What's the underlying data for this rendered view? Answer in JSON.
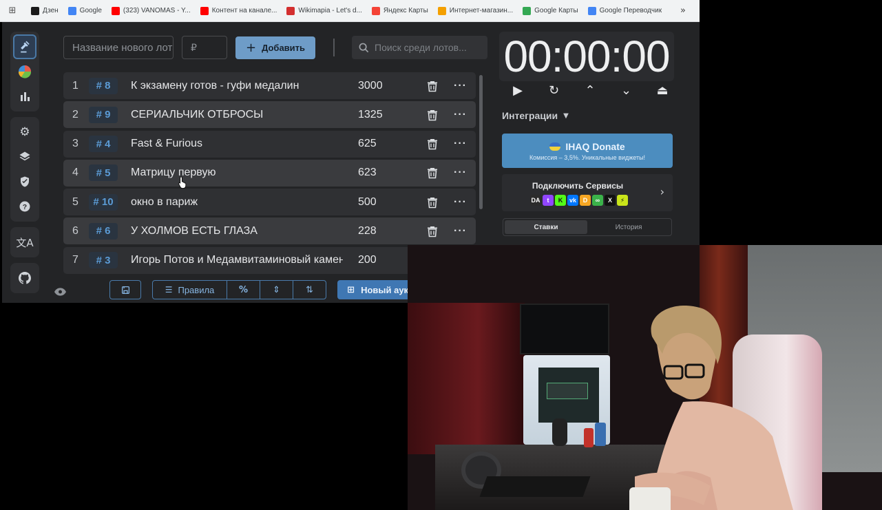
{
  "bookmarks": {
    "items": [
      {
        "label": "Дзен",
        "color": "#1a1a1a"
      },
      {
        "label": "Google",
        "color": "#4285f4"
      },
      {
        "label": "(323) VANOMAS - Y...",
        "color": "#ff0000"
      },
      {
        "label": "Контент на канале...",
        "color": "#ff0000"
      },
      {
        "label": "Wikimapia - Let's d...",
        "color": "#d32f2f"
      },
      {
        "label": "Яндекс Карты",
        "color": "#f44336"
      },
      {
        "label": "Интернет-магазин...",
        "color": "#f4a000"
      },
      {
        "label": "Google Карты",
        "color": "#34a853"
      },
      {
        "label": "Google Переводчик",
        "color": "#4285f4"
      }
    ],
    "more": "»"
  },
  "sidebar": {
    "top": [
      "gavel-icon",
      "pie-chart-icon",
      "bar-chart-icon"
    ],
    "middle": [
      "gear-icon",
      "layers-icon",
      "shield-icon",
      "help-icon"
    ],
    "bottom": [
      "translate-icon"
    ],
    "last": [
      "github-icon"
    ]
  },
  "form": {
    "name_placeholder": "Название нового лота",
    "price_placeholder": "₽",
    "add_label": "Добавить",
    "search_placeholder": "Поиск среди лотов..."
  },
  "lots": [
    {
      "index": "1",
      "tag": "# 8",
      "title": "К экзамену готов - гуфи медалин",
      "amount": "3000"
    },
    {
      "index": "2",
      "tag": "# 9",
      "title": "СЕРИАЛЬЧИК ОТБРОСЫ",
      "amount": "1325"
    },
    {
      "index": "3",
      "tag": "# 4",
      "title": "Fast & Furious",
      "amount": "625"
    },
    {
      "index": "4",
      "tag": "# 5",
      "title": "Матрицу первую",
      "amount": "623"
    },
    {
      "index": "5",
      "tag": "# 10",
      "title": "окно в париж",
      "amount": "500"
    },
    {
      "index": "6",
      "tag": "# 6",
      "title": "У ХОЛМОВ ЕСТЬ ГЛАЗА",
      "amount": "228"
    },
    {
      "index": "7",
      "tag": "# 3",
      "title": "Игорь Потов и Медамвитаминовый камень",
      "amount": "200"
    }
  ],
  "bottom_bar": {
    "rules_label": "Правила",
    "new_auction_label": "Новый аукцион"
  },
  "timer": {
    "value": "00:00:00"
  },
  "integrations": {
    "label": "Интеграции",
    "donate_title": "IHAQ Donate",
    "donate_sub": "Комиссия – 3,5%. Уникальные виджеты!",
    "services_title": "Подключить Сервисы",
    "services": [
      {
        "name": "donationalerts",
        "color": "#2b2b2b",
        "glyph": "DA"
      },
      {
        "name": "twitch",
        "color": "#9146ff",
        "glyph": "t"
      },
      {
        "name": "kick",
        "color": "#53fc18",
        "glyph": "K"
      },
      {
        "name": "vk",
        "color": "#0077ff",
        "glyph": "vk"
      },
      {
        "name": "donatepay",
        "color": "#f5a623",
        "glyph": "D"
      },
      {
        "name": "goodgame",
        "color": "#3bb34a",
        "glyph": "∞"
      },
      {
        "name": "x",
        "color": "#111111",
        "glyph": "X"
      },
      {
        "name": "streamelements",
        "color": "#c9e51a",
        "glyph": "⚡"
      }
    ]
  },
  "tabs": [
    {
      "label": "Ставки",
      "active": true
    },
    {
      "label": "История",
      "active": false
    }
  ]
}
